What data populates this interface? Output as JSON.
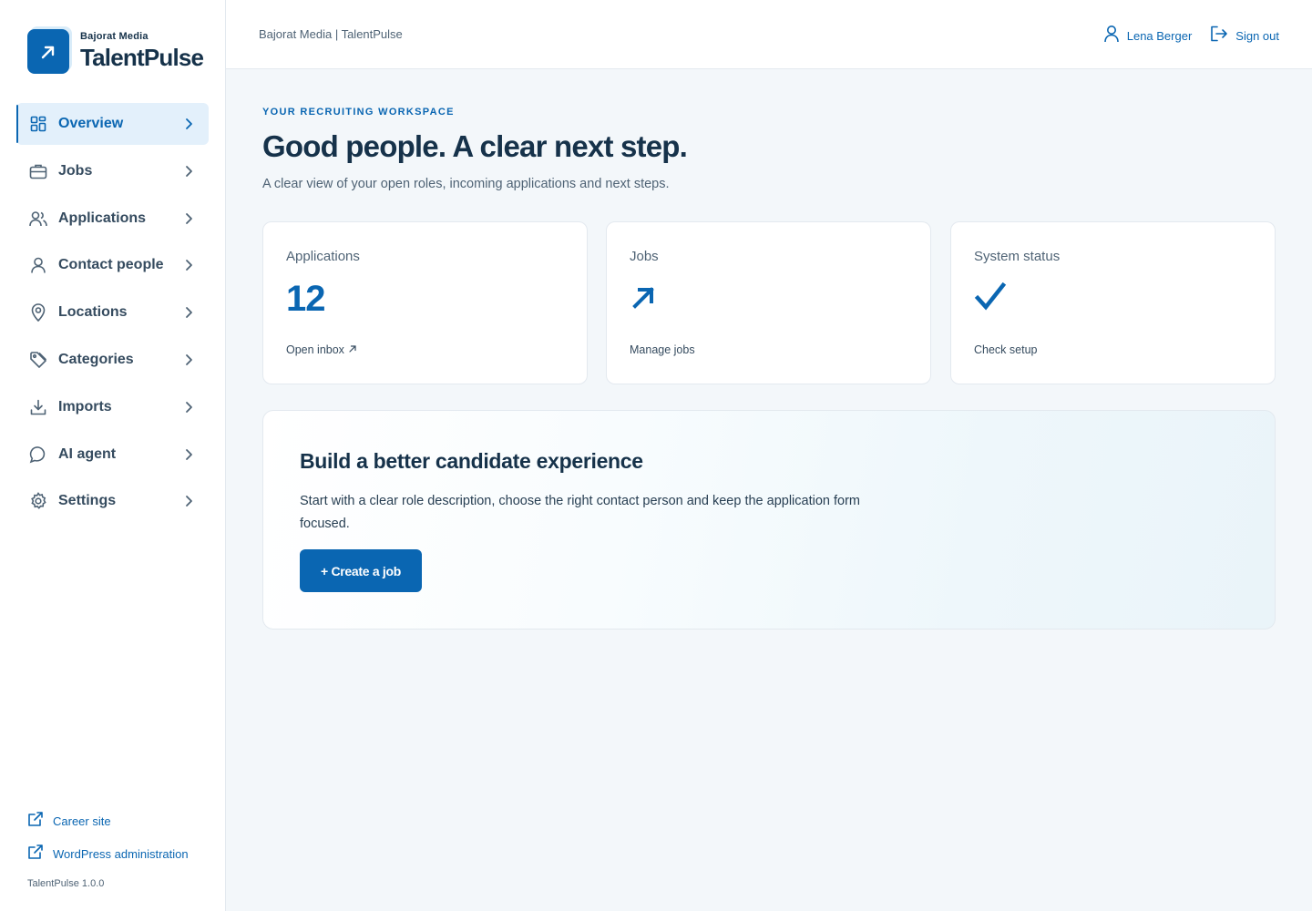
{
  "brand": {
    "company": "Bajorat Media",
    "product": "TalentPulse",
    "logo_icon": "arrow-up-right-icon",
    "accent_color": "#0a66b2"
  },
  "sidebar": {
    "items": [
      {
        "label": "Overview",
        "icon": "grid-icon",
        "active": true
      },
      {
        "label": "Jobs",
        "icon": "briefcase-icon",
        "active": false
      },
      {
        "label": "Applications",
        "icon": "users-icon",
        "active": false
      },
      {
        "label": "Contact people",
        "icon": "user-icon",
        "active": false
      },
      {
        "label": "Locations",
        "icon": "map-pin-icon",
        "active": false
      },
      {
        "label": "Categories",
        "icon": "tag-icon",
        "active": false
      },
      {
        "label": "Imports",
        "icon": "download-icon",
        "active": false
      },
      {
        "label": "AI agent",
        "icon": "chat-bubble-icon",
        "active": false
      },
      {
        "label": "Settings",
        "icon": "gear-icon",
        "active": false
      }
    ],
    "links": [
      {
        "label": "Career site",
        "icon": "external-link-icon"
      },
      {
        "label": "WordPress administration",
        "icon": "external-link-icon"
      }
    ],
    "version": "TalentPulse 1.0.0"
  },
  "header": {
    "breadcrumb": "Bajorat Media | TalentPulse",
    "user_name": "Lena Berger",
    "sign_out": "Sign out"
  },
  "main": {
    "eyebrow": "YOUR RECRUITING WORKSPACE",
    "headline": "Good people. A clear next step.",
    "subline": "A clear view of your open roles, incoming applications and next steps.",
    "cards": [
      {
        "title": "Applications",
        "value": "12",
        "link": "Open inbox"
      },
      {
        "title": "Jobs",
        "glyph": "arrow-up-right-icon",
        "link": "Manage jobs"
      },
      {
        "title": "System status",
        "glyph": "checkmark-icon",
        "link": "Check setup"
      }
    ],
    "promo": {
      "title": "Build a better candidate experience",
      "text": "Start with a clear role description, choose the right contact person and keep the application form focused.",
      "button": "+ Create a job"
    }
  }
}
